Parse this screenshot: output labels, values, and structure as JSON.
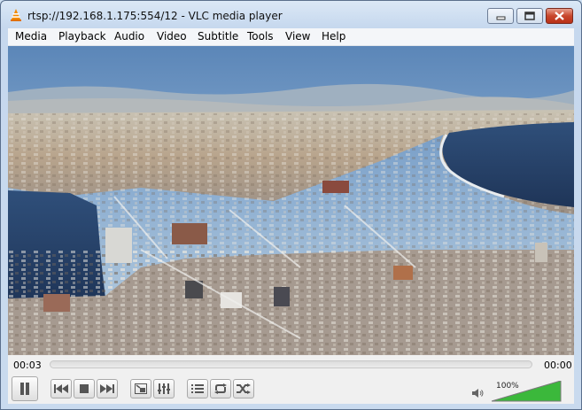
{
  "window": {
    "title": "rtsp://192.168.1.175:554/12 - VLC media player"
  },
  "titlebar_buttons": [
    "minimize",
    "maximize",
    "close"
  ],
  "menu": [
    "Media",
    "Playback",
    "Audio",
    "Video",
    "Subtitle",
    "Tools",
    "View",
    "Help"
  ],
  "player": {
    "elapsed": "00:03",
    "remaining": "00:00",
    "seek_position": 0,
    "volume_label": "100%",
    "volume_level": 1.0
  },
  "controls": {
    "icons": [
      "pause-icon",
      "previous-icon",
      "stop-icon",
      "next-icon",
      "fullscreen-icon",
      "extended-settings-icon",
      "playlist-icon",
      "loop-icon",
      "shuffle-icon",
      "speaker-icon"
    ]
  },
  "colors": {
    "accent_volume": "#3bb83b",
    "close_button": "#c8462c"
  }
}
